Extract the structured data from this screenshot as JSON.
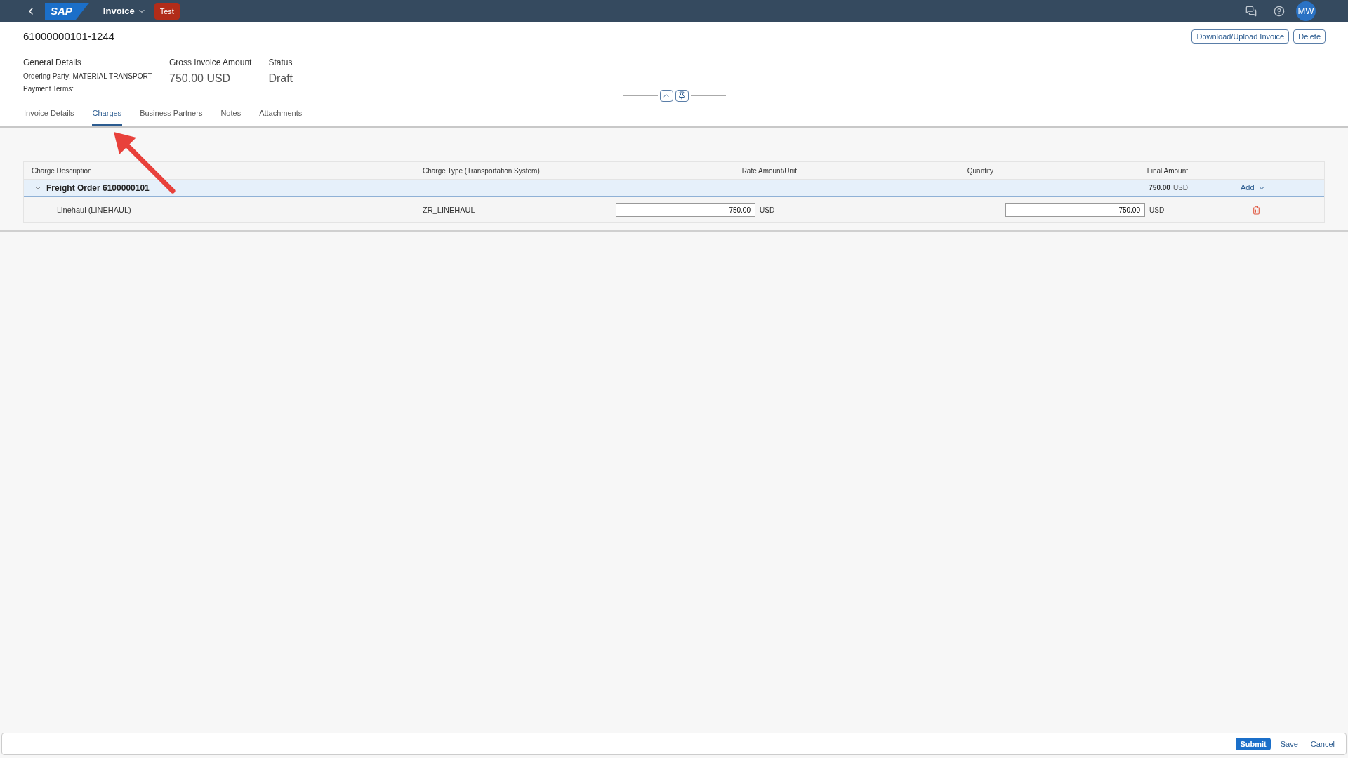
{
  "shell": {
    "logo": "SAP",
    "app_title": "Invoice",
    "system_badge": "Test",
    "avatar": "MW"
  },
  "header": {
    "title": "61000000101-1244",
    "actions": [
      "Download/Upload Invoice",
      "Delete"
    ],
    "general": {
      "label": "General Details",
      "lines": [
        "Ordering Party: MATERIAL TRANSPORT",
        "Payment Terms:"
      ]
    },
    "kpis": [
      {
        "label": "Gross Invoice Amount",
        "value": "750.00 USD"
      },
      {
        "label": "Status",
        "value": "Draft"
      }
    ]
  },
  "tabs": [
    {
      "label": "Invoice Details",
      "selected": false
    },
    {
      "label": "Charges",
      "selected": true
    },
    {
      "label": "Business Partners",
      "selected": false
    },
    {
      "label": "Notes",
      "selected": false
    },
    {
      "label": "Attachments",
      "selected": false
    }
  ],
  "table": {
    "columns": [
      "Charge Description",
      "Charge Type (Transportation System)",
      "Rate Amount/Unit",
      "Quantity",
      "Final Amount"
    ],
    "group": {
      "title": "Freight Order 6100000101",
      "expanded": true,
      "final_amount": "750.00",
      "currency": "USD",
      "add_label": "Add"
    },
    "rows": [
      {
        "description": "Linehaul (LINEHAUL)",
        "type": "ZR_LINEHAUL",
        "rate": "750.00",
        "rate_currency": "USD",
        "final": "750.00",
        "final_currency": "USD"
      }
    ]
  },
  "footer": {
    "buttons": [
      {
        "label": "Submit",
        "kind": "primary"
      },
      {
        "label": "Save",
        "kind": "plain"
      },
      {
        "label": "Cancel",
        "kind": "plain"
      }
    ]
  }
}
